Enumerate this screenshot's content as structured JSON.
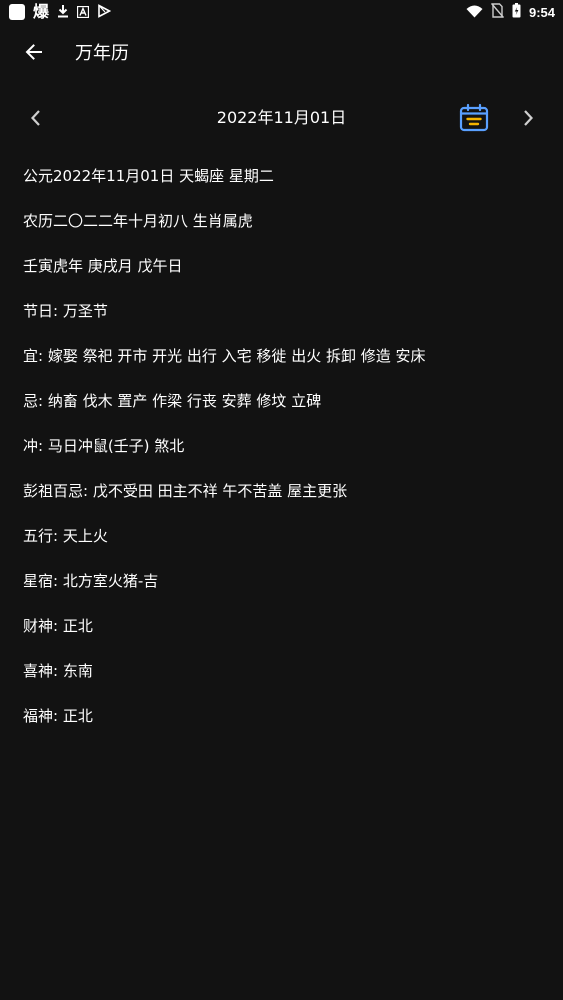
{
  "status_bar": {
    "time": "9:54",
    "left_glyphs": [
      "爆"
    ],
    "icons": [
      "app-icon",
      "baozi-icon",
      "download-icon",
      "font-icon",
      "play-icon",
      "wifi-icon",
      "sim-off-icon",
      "battery-icon"
    ]
  },
  "app_bar": {
    "title": "万年历",
    "back_icon": "arrow-left-icon"
  },
  "date_nav": {
    "date": "2022年11月01日",
    "prev_icon": "chevron-left-icon",
    "next_icon": "chevron-right-icon",
    "calendar_icon": "calendar-icon",
    "accent_color": "#5aa0ff",
    "calendar_bar_color": "#f4b400"
  },
  "info": {
    "lines": [
      "公元2022年11月01日 天蝎座 星期二",
      "农历二〇二二年十月初八 生肖属虎",
      "壬寅虎年 庚戌月 戊午日",
      "节日: 万圣节",
      "宜: 嫁娶 祭祀 开市 开光 出行 入宅 移徙 出火 拆卸 修造 安床",
      "忌: 纳畜 伐木 置产 作梁 行丧 安葬 修坟 立碑",
      "冲: 马日冲鼠(壬子) 煞北",
      "彭祖百忌: 戊不受田 田主不祥 午不苦盖 屋主更张",
      "五行: 天上火",
      "星宿: 北方室火猪-吉",
      "财神: 正北",
      "喜神: 东南",
      "福神: 正北"
    ]
  }
}
